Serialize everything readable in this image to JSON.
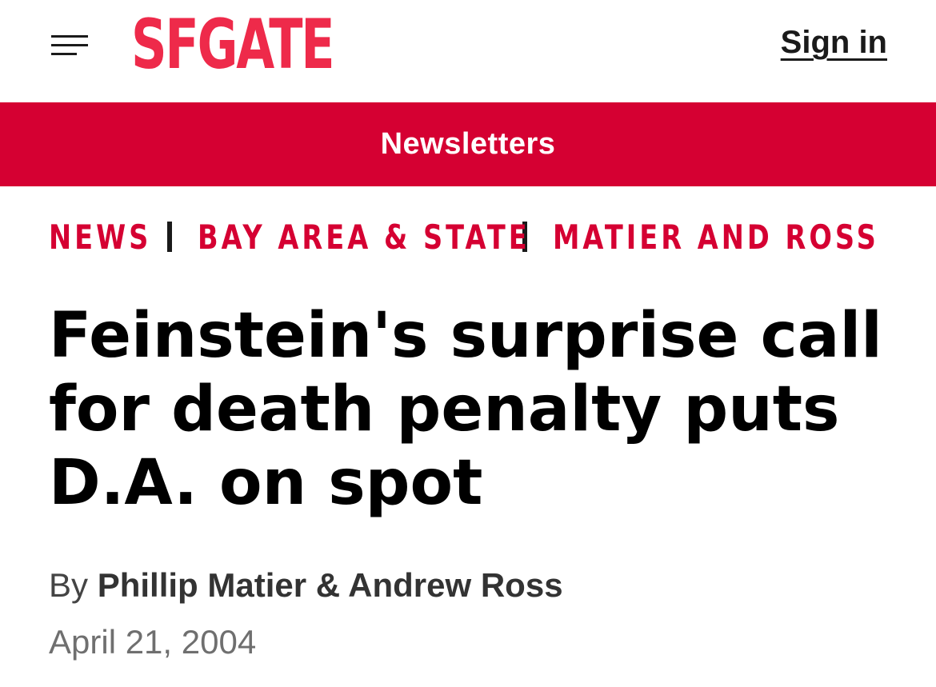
{
  "header": {
    "menu_icon": "hamburger-menu-icon",
    "logo_text": "SFGATE",
    "sign_in_label": "Sign in"
  },
  "banner": {
    "newsletters_label": "Newsletters"
  },
  "breadcrumb": {
    "items": [
      {
        "label": "NEWS"
      },
      {
        "label": "BAY AREA & STATE"
      },
      {
        "label": "MATIER AND ROSS"
      }
    ],
    "separator": "|"
  },
  "article": {
    "headline": "Feinstein's surprise call for death penalty puts D.A. on spot",
    "byline_prefix": "By",
    "authors": "Phillip Matier & Andrew Ross",
    "date": "April 21, 2004"
  },
  "colors": {
    "brand_red": "#d50032",
    "logo_red": "#ee2a4a",
    "text_dark": "#000000",
    "text_muted": "#6f6f6f"
  }
}
